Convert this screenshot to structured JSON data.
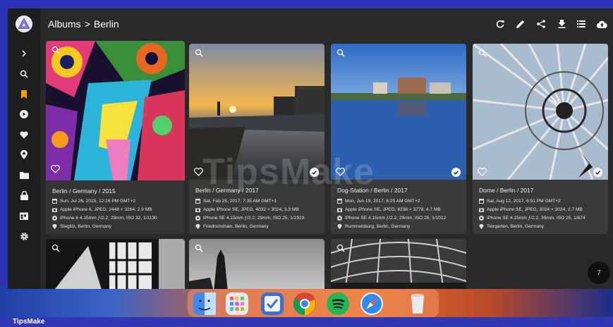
{
  "window": {
    "breadcrumb": {
      "parent": "Albums",
      "separator": ">",
      "current": "Berlin"
    }
  },
  "sidebar": {
    "icons": [
      "chevron-right-icon",
      "search-icon",
      "bookmark-icon",
      "play-icon",
      "heart-icon",
      "location-pin-icon",
      "folder-icon",
      "lock-icon",
      "calendar-icon",
      "gear-icon"
    ]
  },
  "toolbar": {
    "icons": [
      "refresh-icon",
      "edit-icon",
      "share-icon",
      "download-icon",
      "list-view-icon",
      "upload-cloud-icon"
    ]
  },
  "colors": {
    "accent": "#f0a000",
    "window_bg": "#2a2a2a",
    "sidebar_bg": "#1e1e1e",
    "card_bg": "#3a3a3a"
  },
  "photos": [
    {
      "title": "Berlin / Germany / 2015",
      "date": "Sun, Jul 26, 2015, 12:26 PM GMT+2",
      "camera": "Apple iPhone 6, JPEG, 2448 × 3264, 2.9 MB",
      "lens": "iPhone 6 4.15mm ƒ/2.2, 29mm, ISO 32, 1/1130",
      "location": "Steglitz, Berlin, Germany"
    },
    {
      "title": "Berlin / Germany / 2017",
      "date": "Sat, Feb 25, 2017, 7:35 AM GMT+1",
      "camera": "Apple iPhone SE, JPEG, 4032 × 3024, 3.3 MB",
      "lens": "iPhone SE 4.15mm ƒ/2.2, 29mm, ISO 25, 1/1923",
      "location": "Friedrichshain, Berlin, Germany"
    },
    {
      "title": "Dog-Station / Berlin / 2017",
      "date": "Mon, Jun 19, 2017, 6:25 AM GMT+2",
      "camera": "Apple iPhone SE, JPEG, 8238 × 3778, 4.7 MB",
      "lens": "iPhone SE 4.15mm ƒ/2.2, 29mm, ISO 25, 1/1012",
      "location": "Rummelsburg, Berlin, Germany"
    },
    {
      "title": "Dome / Berlin / 2017",
      "date": "Sat, Aug 12, 2017, 6:51 PM GMT+2",
      "camera": "Apple iPhone SE, JPEG, 3024 × 3024, 2.7 MB",
      "lens": "iPhone SE 4.15mm ƒ/2.2, 39mm, ISO 25, 1/674",
      "location": "Tiergarten, Berlin, Germany"
    }
  ],
  "count_badge": "7",
  "watermark": "TipsMake",
  "brand": "TipsMake",
  "dock": {
    "apps": [
      "finder-icon",
      "launchpad-icon",
      "tasks-icon",
      "chrome-icon",
      "spotify-icon",
      "safari-icon",
      "trash-icon"
    ]
  }
}
